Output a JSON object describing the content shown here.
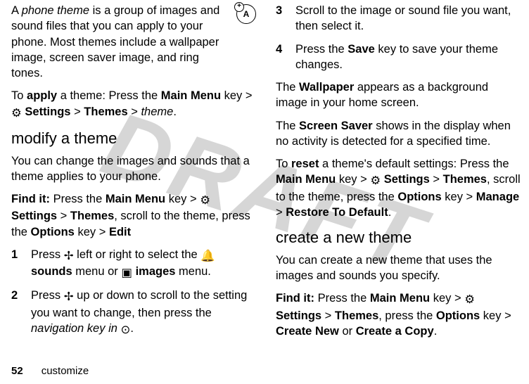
{
  "watermark": "DRAFT",
  "left": {
    "intro_a": "A ",
    "intro_phone_theme": "phone theme",
    "intro_b": " is a group of images and sound files that you can apply to your phone. Most themes include a wallpaper image, screen saver image, and ring tones.",
    "apply_a": "To ",
    "apply_bold": "apply",
    "apply_b": " a theme: Press the ",
    "main_menu": "Main Menu",
    "apply_c": " key > ",
    "settings_icon": "⚙",
    "settings": "Settings",
    "gt": " > ",
    "themes": "Themes",
    "apply_d": " > ",
    "theme_word": "theme",
    "period": ".",
    "h_modify": "modify a theme",
    "modify_p": "You can change the images and sounds that a theme applies to your phone.",
    "findit_label": "Find it:",
    "findit_a": " Press the ",
    "findit_b": " key > ",
    "findit_c": ", scroll to the theme, press the ",
    "options": "Options",
    "findit_d": " key > ",
    "edit": " Edit",
    "step1_num": "1",
    "step1_a": "Press ",
    "nav_icon": "✢",
    "step1_b": " left or right to select the ",
    "bell_icon": "🔔",
    "sounds": "sounds",
    "step1_c": " menu or ",
    "img_icon": "▣",
    "images": "images",
    "step1_d": " menu.",
    "step2_num": "2",
    "step2_a": "Press ",
    "step2_b": " up or down to scroll to the setting you want to change, then press the ",
    "nav_key_in": "navigation key in",
    "center_icon": "⊙",
    "step2_c": " ",
    "step2_d": "."
  },
  "right": {
    "step3_num": "3",
    "step3": "Scroll to the image or sound file you want, then select it.",
    "step4_num": "4",
    "step4_a": "Press the ",
    "save": "Save",
    "step4_b": " key to save your theme changes.",
    "wall_a": "The ",
    "wallpaper": "Wallpaper",
    "wall_b": " appears as a background image in your home screen.",
    "ss_a": "The ",
    "screensaver": "Screen Saver",
    "ss_b": " shows in the display when no activity is detected for a specified time.",
    "reset_a": "To ",
    "reset_bold": "reset",
    "reset_b": " a theme's default settings: Press the ",
    "reset_c": " key > ",
    "reset_d": ", scroll to the theme, press the ",
    "reset_e": " key > ",
    "manage": "Manage",
    "reset_f": " > ",
    "restore": "Restore To Default",
    "h_create": "create a new theme",
    "create_p": "You can create a new theme that uses the images and sounds you specify.",
    "create_findit_a": " Press the ",
    "create_findit_b": " key > ",
    "create_findit_c": ", press the ",
    "create_findit_d": " key > ",
    "create_new": " Create New",
    "or": " or ",
    "create_copy": "Create a Copy"
  },
  "footer": {
    "page": "52",
    "section": "customize"
  },
  "badge_letter": "A"
}
